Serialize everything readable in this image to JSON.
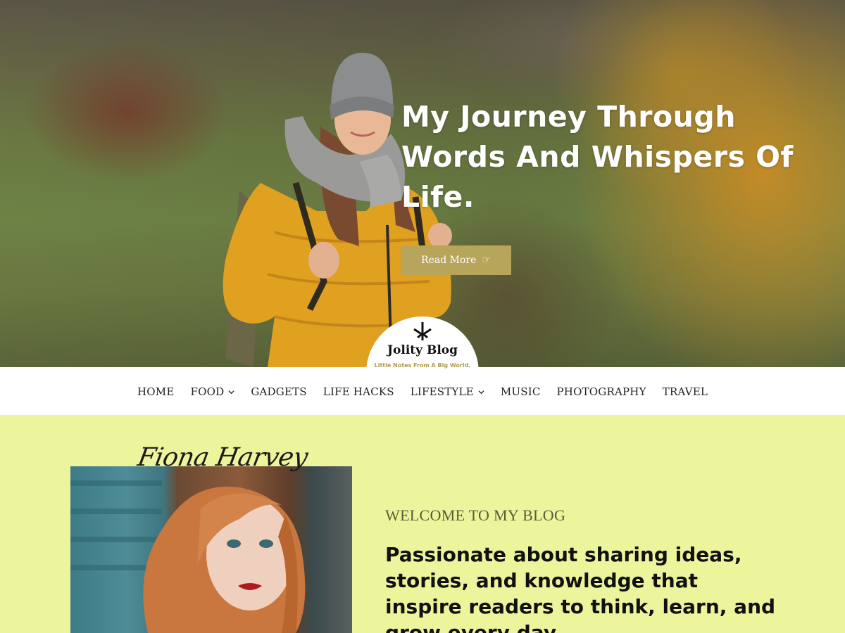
{
  "hero": {
    "title": "My Journey Through Words And Whispers Of Life.",
    "read_more_label": "Read More",
    "read_more_icon": "hand-pointing-right-icon"
  },
  "logo": {
    "name": "Jolity Blog",
    "tagline": "Little Notes From A Big World."
  },
  "nav": {
    "items": [
      {
        "label": "HOME",
        "has_dropdown": false
      },
      {
        "label": "FOOD",
        "has_dropdown": true
      },
      {
        "label": "GADGETS",
        "has_dropdown": false
      },
      {
        "label": "LIFE HACKS",
        "has_dropdown": false
      },
      {
        "label": "LIFESTYLE",
        "has_dropdown": true
      },
      {
        "label": "MUSIC",
        "has_dropdown": false
      },
      {
        "label": "PHOTOGRAPHY",
        "has_dropdown": false
      },
      {
        "label": "TRAVEL",
        "has_dropdown": false
      }
    ]
  },
  "about": {
    "signature": "Fiona Harvey",
    "welcome": "WELCOME TO MY BLOG",
    "text": "Passionate about sharing ideas, stories, and knowledge that inspire readers to think, learn, and grow every day."
  },
  "colors": {
    "accent": "#b6a55a",
    "about_background": "#edf59c",
    "nav_background": "#ffffff"
  }
}
